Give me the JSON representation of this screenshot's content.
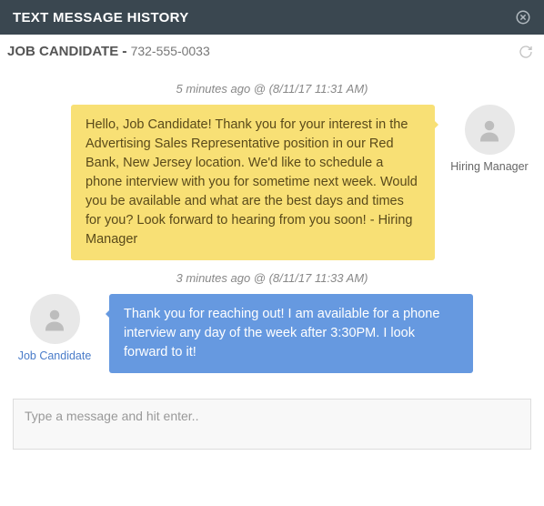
{
  "header": {
    "title": "TEXT MESSAGE HISTORY"
  },
  "subheader": {
    "candidate_name": "JOB CANDIDATE",
    "dash": "-",
    "phone": "732-555-0033"
  },
  "messages": [
    {
      "timestamp": "5 minutes ago @ (8/11/17 11:31 AM)",
      "direction": "outgoing",
      "sender_name": "Hiring Manager",
      "sender_is_link": false,
      "bubble_class": "yellow",
      "text": "Hello, Job Candidate! Thank you for your interest in the Advertising Sales Representative position in our Red Bank, New Jersey location. We'd like to schedule a phone interview with you for sometime next week. Would you be available and what are the best days and times for you? Look forward to hearing from you soon! - Hiring Manager"
    },
    {
      "timestamp": "3 minutes ago @ (8/11/17 11:33 AM)",
      "direction": "incoming",
      "sender_name": "Job Candidate",
      "sender_is_link": true,
      "bubble_class": "blue",
      "text": "Thank you for reaching out! I am available for a phone interview any day of the week after 3:30PM. I look forward to it!"
    }
  ],
  "input": {
    "placeholder": "Type a message and hit enter.."
  }
}
